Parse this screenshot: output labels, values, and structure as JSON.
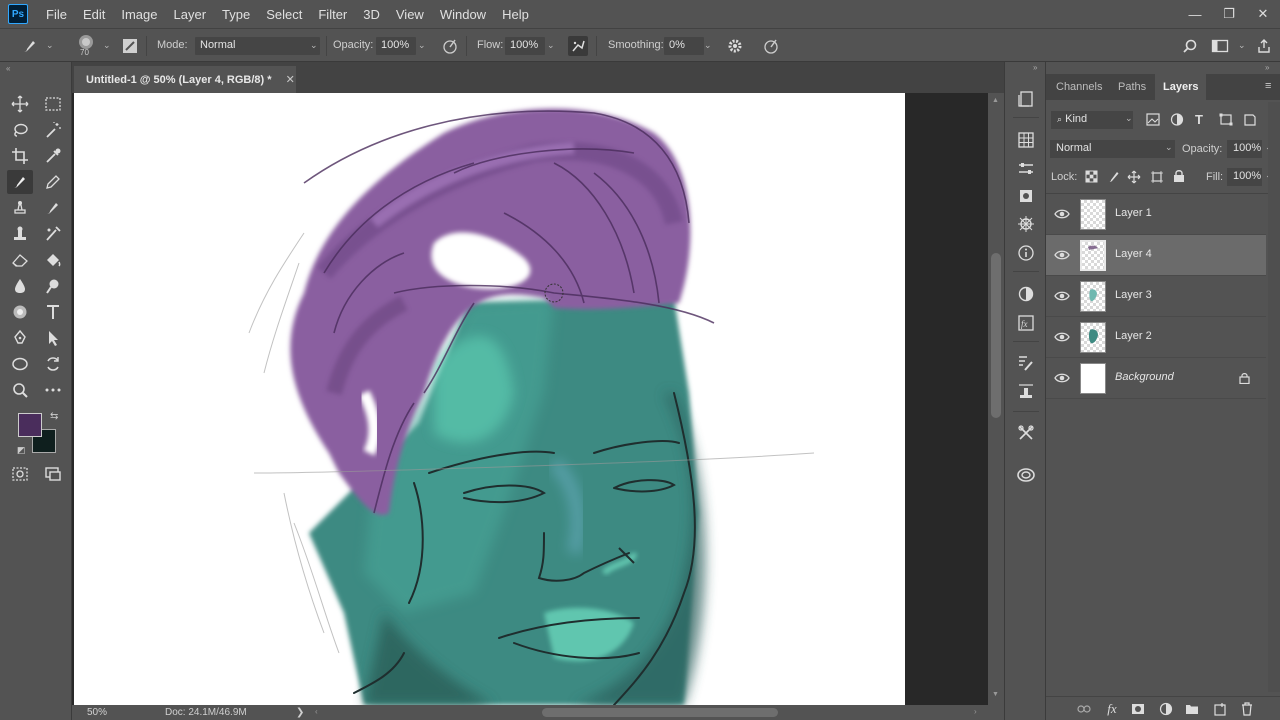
{
  "app": {
    "logo": "Ps"
  },
  "menu": [
    "File",
    "Edit",
    "Image",
    "Layer",
    "Type",
    "Select",
    "Filter",
    "3D",
    "View",
    "Window",
    "Help"
  ],
  "window_controls": {
    "minimize": "—",
    "restore": "❐",
    "close": "✕"
  },
  "options": {
    "brush_size": "70",
    "mode_label": "Mode:",
    "mode_value": "Normal",
    "opacity_label": "Opacity:",
    "opacity_value": "100%",
    "flow_label": "Flow:",
    "flow_value": "100%",
    "smoothing_label": "Smoothing:",
    "smoothing_value": "0%"
  },
  "document": {
    "tab_title": "Untitled-1 @ 50% (Layer 4, RGB/8) *",
    "tab_close": "✕"
  },
  "status": {
    "zoom": "50%",
    "doc_size": "Doc: 24.1M/46.9M",
    "arrow": "❯"
  },
  "panel": {
    "tabs": [
      "Channels",
      "Paths",
      "Layers"
    ],
    "active_tab": "Layers",
    "filter_kind": "Kind",
    "blend_mode": "Normal",
    "opacity_label": "Opacity:",
    "opacity_value": "100%",
    "lock_label": "Lock:",
    "fill_label": "Fill:",
    "fill_value": "100%",
    "layers": [
      {
        "name": "Layer 1",
        "visible": true,
        "selected": false,
        "locked": false
      },
      {
        "name": "Layer 4",
        "visible": true,
        "selected": true,
        "locked": false
      },
      {
        "name": "Layer 3",
        "visible": true,
        "selected": false,
        "locked": false
      },
      {
        "name": "Layer 2",
        "visible": true,
        "selected": false,
        "locked": false
      },
      {
        "name": "Background",
        "visible": true,
        "selected": false,
        "locked": true
      }
    ]
  },
  "colors": {
    "foreground": "#4a2d5c",
    "background": "#0f1f1e",
    "accent": "#31a8ff"
  }
}
